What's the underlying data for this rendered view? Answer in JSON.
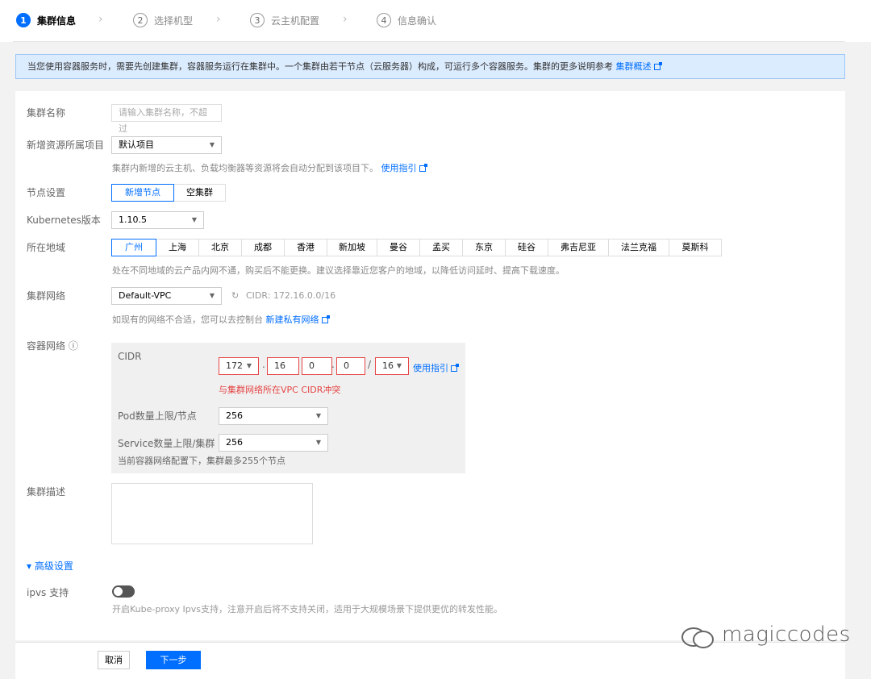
{
  "stepper": {
    "steps": [
      {
        "num": "1",
        "label": "集群信息"
      },
      {
        "num": "2",
        "label": "选择机型"
      },
      {
        "num": "3",
        "label": "云主机配置"
      },
      {
        "num": "4",
        "label": "信息确认"
      }
    ]
  },
  "notice": {
    "text": "当您使用容器服务时，需要先创建集群，容器服务运行在集群中。一个集群由若干节点（云服务器）构成，可运行多个容器服务。集群的更多说明参考 ",
    "link": "集群概述"
  },
  "form": {
    "cluster_name": {
      "label": "集群名称",
      "placeholder": "请输入集群名称，不超过"
    },
    "project": {
      "label": "新增资源所属项目",
      "value": "默认项目",
      "hint": "集群内新增的云主机、负载均衡器等资源将会自动分配到该项目下。",
      "hint_link": "使用指引"
    },
    "node_setting": {
      "label": "节点设置",
      "options": [
        "新增节点",
        "空集群"
      ]
    },
    "k8s_version": {
      "label": "Kubernetes版本",
      "value": "1.10.5"
    },
    "region": {
      "label": "所在地域",
      "options": [
        "广州",
        "上海",
        "北京",
        "成都",
        "香港",
        "新加坡",
        "曼谷",
        "孟买",
        "东京",
        "硅谷",
        "弗吉尼亚",
        "法兰克福",
        "莫斯科"
      ],
      "hint": "处在不同地域的云产品内网不通，购买后不能更换。建议选择靠近您客户的地域，以降低访问延时、提高下载速度。"
    },
    "cluster_network": {
      "label": "集群网络",
      "value": "Default-VPC",
      "cidr": "CIDR: 172.16.0.0/16",
      "hint": "如现有的网络不合适，您可以去控制台 ",
      "hint_link": "新建私有网络"
    },
    "container_network": {
      "label": "容器网络 ⓘ",
      "cidr_label": "CIDR",
      "cidr_parts": [
        "172",
        "16",
        "0",
        "0"
      ],
      "cidr_mask": "16",
      "cidr_link": "使用指引",
      "error": "与集群网络所在VPC CIDR冲突",
      "pod_label": "Pod数量上限/节点",
      "pod_value": "256",
      "service_label": "Service数量上限/集群",
      "service_value": "256",
      "note": "当前容器网络配置下，集群最多255个节点"
    },
    "description": {
      "label": "集群描述"
    },
    "advanced": {
      "label": "▾ 高级设置"
    },
    "ipvs": {
      "label": "ipvs 支持",
      "hint": "开启Kube-proxy Ipvs支持，注意开启后将不支持关闭，适用于大规模场景下提供更优的转发性能。"
    }
  },
  "footer": {
    "cancel": "取消",
    "next": "下一步"
  },
  "watermark": "magiccodes"
}
